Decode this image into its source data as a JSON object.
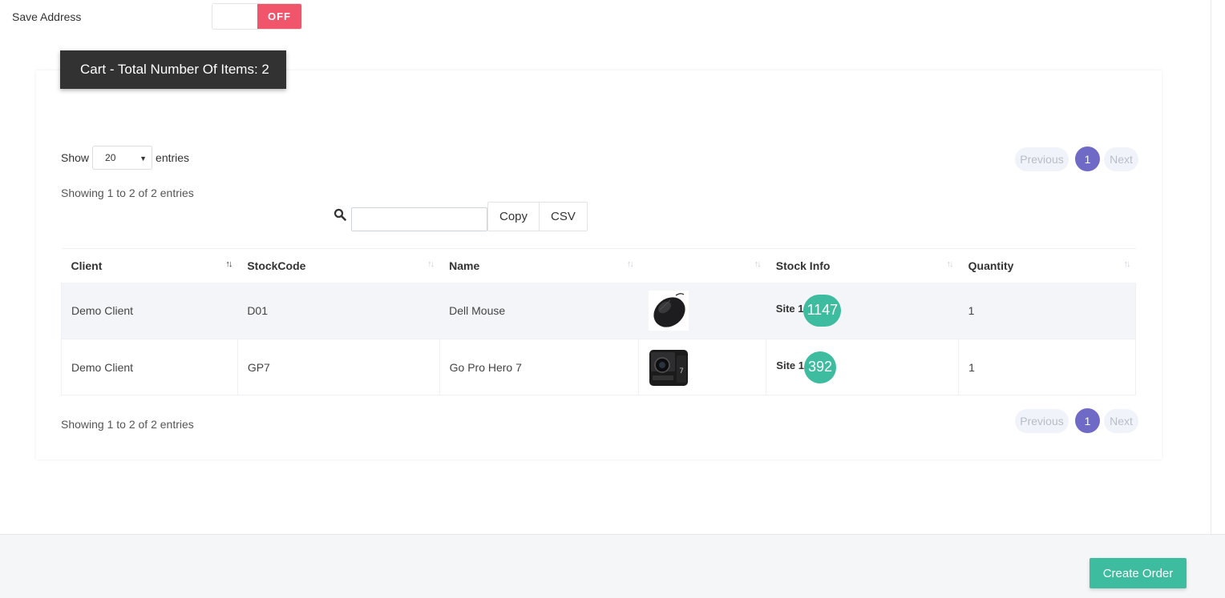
{
  "save_address": {
    "label": "Save Address",
    "toggle_state": "OFF"
  },
  "cart_banner": {
    "title": "Cart - Total Number Of Items: 2"
  },
  "length_menu": {
    "prefix": "Show",
    "selected": "20",
    "suffix": "entries"
  },
  "info_top": "Showing 1 to 2 of 2 entries",
  "info_bottom": "Showing 1 to 2 of 2 entries",
  "pagination": {
    "previous": "Previous",
    "current": "1",
    "next": "Next"
  },
  "search": {
    "icon": "search-icon",
    "value": ""
  },
  "export_buttons": {
    "copy": "Copy",
    "csv": "CSV"
  },
  "table": {
    "columns": [
      "Client",
      "StockCode",
      "Name",
      "",
      "Stock Info",
      "Quantity"
    ],
    "rows": [
      {
        "client": "Demo Client",
        "stock_code": "D01",
        "name": "Dell Mouse",
        "image": "mouse-image",
        "site": "Site 1",
        "stock": "1147",
        "quantity": "1"
      },
      {
        "client": "Demo Client",
        "stock_code": "GP7",
        "name": "Go Pro Hero 7",
        "image": "camera-image",
        "site": "Site 1",
        "stock": "392",
        "quantity": "1"
      }
    ]
  },
  "footer": {
    "create_order": "Create Order"
  },
  "colors": {
    "toggle_off": "#f1556c",
    "pagination_active": "#6f6ac6",
    "stock_badge": "#3dbc9f",
    "create_order": "#3dbc9f",
    "banner": "#323232"
  }
}
